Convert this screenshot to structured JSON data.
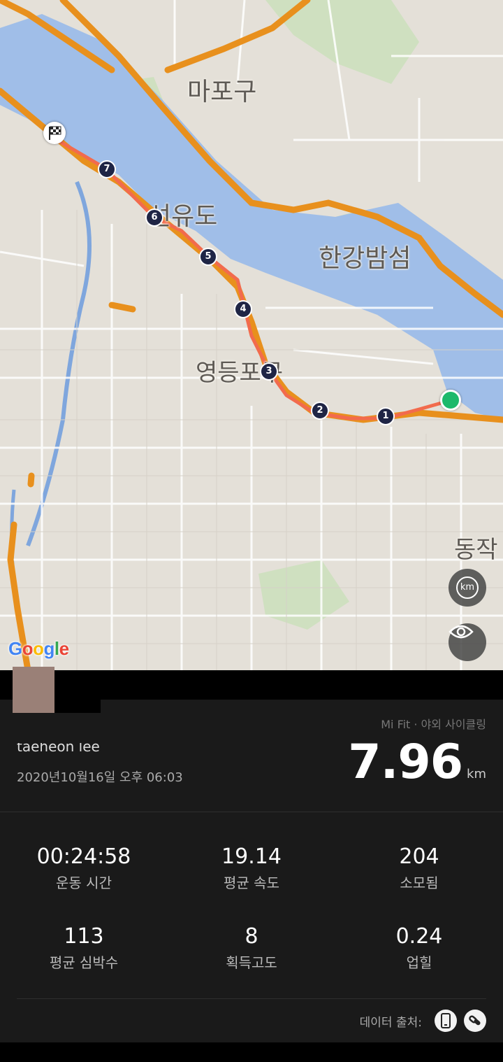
{
  "map": {
    "labels": {
      "mapo": "마포구",
      "seonyudo": "선유도",
      "hangang": "한강밤섬",
      "yeongdeungpo": "영등포구",
      "dongjak": "동작"
    },
    "markers": [
      "1",
      "2",
      "3",
      "4",
      "5",
      "6",
      "7"
    ],
    "km_button": "km",
    "google": [
      "G",
      "o",
      "o",
      "g",
      "l",
      "e"
    ],
    "route_color": "#f26b4d",
    "road_color": "#e8901d",
    "water_color": "#9fbfea"
  },
  "activity": {
    "username": "taeheon lee",
    "datetime": "2020년10월16일 오후 06:03",
    "source": "Mi Fit · 야외 사이클링",
    "distance_value": "7.96",
    "distance_unit": "km"
  },
  "stats": [
    {
      "value": "00:24:58",
      "label": "운동 시간"
    },
    {
      "value": "19.14",
      "label": "평균 속도"
    },
    {
      "value": "204",
      "label": "소모됨"
    },
    {
      "value": "113",
      "label": "평균 심박수"
    },
    {
      "value": "8",
      "label": "획득고도"
    },
    {
      "value": "0.24",
      "label": "업힐"
    }
  ],
  "footer": {
    "data_source_label": "데이터 출처:",
    "icons": [
      "phone-icon",
      "link-icon"
    ]
  }
}
